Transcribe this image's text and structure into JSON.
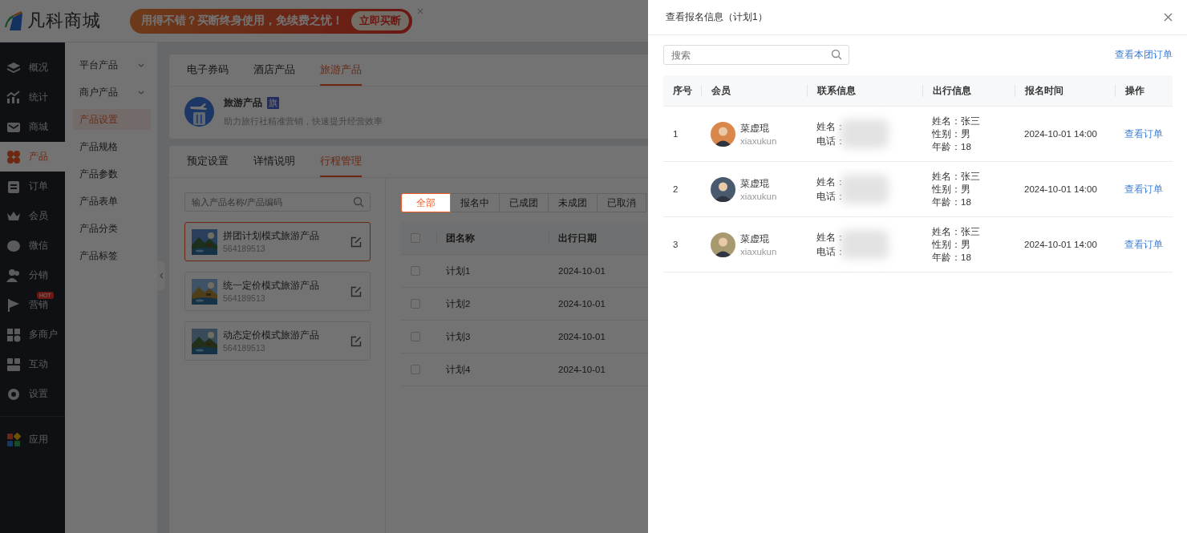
{
  "header": {
    "logo_text": "凡科商城",
    "banner": {
      "text": "用得不错？买断终身使用，免续费之忧！",
      "button": "立即买断"
    }
  },
  "sidebar": {
    "items": [
      {
        "label": "概况",
        "kind": "overview",
        "selected": false
      },
      {
        "label": "统计",
        "kind": "stats",
        "selected": false
      },
      {
        "label": "商城",
        "kind": "shop",
        "selected": false
      },
      {
        "label": "产品",
        "kind": "product",
        "selected": true
      },
      {
        "label": "订单",
        "kind": "order",
        "selected": false
      },
      {
        "label": "会员",
        "kind": "member",
        "selected": false
      },
      {
        "label": "微信",
        "kind": "wechat",
        "selected": false
      },
      {
        "label": "分销",
        "kind": "distribution",
        "selected": false
      },
      {
        "label": "营销",
        "kind": "marketing",
        "selected": false,
        "badge": "HOT"
      },
      {
        "label": "多商户",
        "kind": "merchant",
        "selected": false
      },
      {
        "label": "互动",
        "kind": "interact",
        "selected": false
      },
      {
        "label": "设置",
        "kind": "settings",
        "selected": false
      },
      {
        "label": "应用",
        "kind": "apps",
        "selected": false
      }
    ]
  },
  "subnav": {
    "items": [
      {
        "label": "平台产品",
        "kind": "group",
        "selected": false
      },
      {
        "label": "商户产品",
        "kind": "group",
        "selected": false
      },
      {
        "label": "产品设置",
        "kind": "link",
        "selected": true
      },
      {
        "label": "产品规格",
        "kind": "link",
        "selected": false
      },
      {
        "label": "产品参数",
        "kind": "link",
        "selected": false
      },
      {
        "label": "产品表单",
        "kind": "link",
        "selected": false
      },
      {
        "label": "产品分类",
        "kind": "link",
        "selected": false
      },
      {
        "label": "产品标签",
        "kind": "link",
        "selected": false
      }
    ]
  },
  "main": {
    "product_tabs": [
      {
        "label": "电子券码",
        "selected": false
      },
      {
        "label": "酒店产品",
        "selected": false
      },
      {
        "label": "旅游产品",
        "selected": true
      }
    ],
    "product_header": {
      "title": "旅游产品",
      "badge": "旗",
      "description": "助力旅行社精准营销，快速提升经营效率"
    },
    "detail_tabs": [
      {
        "label": "预定设置",
        "selected": false
      },
      {
        "label": "详情说明",
        "selected": false
      },
      {
        "label": "行程管理",
        "selected": true
      }
    ],
    "product_search": {
      "placeholder": "输入产品名称/产品编码"
    },
    "products": [
      {
        "name": "拼团计划模式旅游产品",
        "code": "564189513",
        "selected": true
      },
      {
        "name": "统一定价模式旅游产品",
        "code": "564189513",
        "selected": false
      },
      {
        "name": "动态定价模式旅游产品",
        "code": "564189513",
        "selected": false
      }
    ],
    "status_filters": [
      {
        "label": "全部",
        "selected": true
      },
      {
        "label": "报名中",
        "selected": false
      },
      {
        "label": "已成团",
        "selected": false
      },
      {
        "label": "未成团",
        "selected": false
      },
      {
        "label": "已取消",
        "selected": false
      }
    ],
    "group_table": {
      "all_checked": false,
      "columns": [
        "团名称",
        "出行日期"
      ],
      "rows": [
        {
          "name": "计划1",
          "date": "2024-10-01",
          "checked": false
        },
        {
          "name": "计划2",
          "date": "2024-10-01",
          "checked": false
        },
        {
          "name": "计划3",
          "date": "2024-10-01",
          "checked": false
        },
        {
          "name": "计划4",
          "date": "2024-10-01",
          "checked": false
        }
      ]
    }
  },
  "drawer": {
    "title": "查看报名信息（计划1）",
    "search": {
      "placeholder": "搜索"
    },
    "link": "查看本团订单",
    "columns": [
      "序号",
      "会员",
      "联系信息",
      "出行信息",
      "报名时间",
      "操作"
    ],
    "rows": [
      {
        "index": "1",
        "member": {
          "name": "菜虚琨",
          "account": "xiaxukun"
        },
        "contact": [
          "姓名：",
          "电话："
        ],
        "travel": [
          "姓名：张三",
          "性别：男",
          "年龄：18"
        ],
        "time": "2024-10-01 14:00",
        "action": "查看订单"
      },
      {
        "index": "2",
        "member": {
          "name": "菜虚琨",
          "account": "xiaxukun"
        },
        "contact": [
          "姓名：",
          "电话："
        ],
        "travel": [
          "姓名：张三",
          "性别：男",
          "年龄：18"
        ],
        "time": "2024-10-01 14:00",
        "action": "查看订单"
      },
      {
        "index": "3",
        "member": {
          "name": "菜虚琨",
          "account": "xiaxukun"
        },
        "contact": [
          "姓名：",
          "电话："
        ],
        "travel": [
          "姓名：张三",
          "性别：男",
          "年龄：18"
        ],
        "time": "2024-10-01 14:00",
        "action": "查看订单"
      }
    ]
  }
}
